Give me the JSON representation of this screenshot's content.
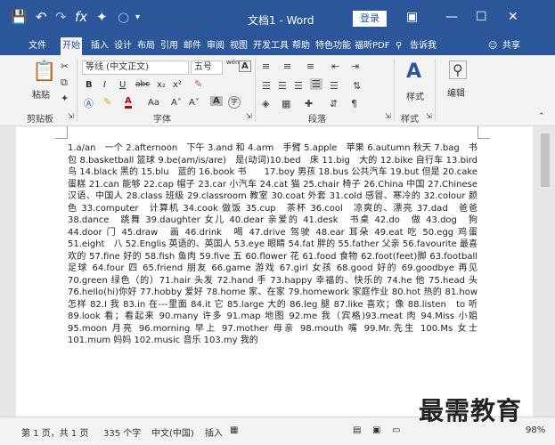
{
  "titlebar": {
    "save_icon": "save-icon",
    "undo_icon": "undo-icon",
    "redo_icon": "redo-icon",
    "formula_icon": "formula-icon",
    "brush_icon": "brush-icon",
    "circle_icon": "circle-icon",
    "customize_icon": "customize-icon",
    "title": "文档1 - Word",
    "login_label": "登录"
  },
  "tabs": [
    {
      "label": "文件"
    },
    {
      "label": "开始"
    },
    {
      "label": "插入"
    },
    {
      "label": "设计"
    },
    {
      "label": "布局"
    },
    {
      "label": "引用"
    },
    {
      "label": "邮件"
    },
    {
      "label": "审阅"
    },
    {
      "label": "视图"
    },
    {
      "label": "开发工具"
    },
    {
      "label": "帮助"
    },
    {
      "label": "特色功能"
    },
    {
      "label": "福昕PDF"
    },
    {
      "label": "告诉我"
    },
    {
      "label": "共享"
    }
  ],
  "ribbon": {
    "paste_label": "粘贴",
    "clipboard_group": "剪贴板",
    "font_name": "等线 (中文正文)",
    "font_size": "五号",
    "wen_label": "wén",
    "font_group": "字体",
    "paragraph_group": "段落",
    "style_label": "样式",
    "style_group": "样式",
    "edit_label": "编辑",
    "bold": "B",
    "italic": "I",
    "underline": "U",
    "strike": "abc",
    "subscript": "x₂",
    "superscript": "x²",
    "font_color_a": "A",
    "grow": "A˄",
    "shrink": "A˅",
    "aa_label": "Aa",
    "boxed_a": "A",
    "char_circle": "字"
  },
  "document": {
    "text": "1.a/an　一个 2.afternoon　下午 3.and 和 4.arm　手臂 5.apple　苹果 6.autumn 秋天 7.bag　书包 8.basketball 篮球 9.be(am/is/are)　是(动词)10.bed　床 11.big　大的 12.bike 自行车 13.bird 鸟 14.black 黑的 15.blu　蓝的 16.book 书　　17.boy 男孩 18.bus 公共汽车 19.but 但是 20.cake　蛋糕 21.can 能够 22.cap 帽子 23.car 小汽车 24.cat 猫 25.chair 椅子 26.China 中国 27.Chinese 汉语、中国人 28.class 班级 29.classroom 教室 30.coat 外套 31.cold 感冒、寒冷的 32.colour 颜色 33.computer　计算机 34.cook 做饭 35.cup　茶杯 36.cool　凉爽的、漂亮 37.dad　爸爸 38.dance　跳舞 39.daughter 女儿 40.dear 亲爱的 41.desk　书桌 42.do　做 43.dog　狗 44.door 门 45.draw　画 46.drink　喝 47.drive 驾驶 48.ear 耳朵 49.eat 吃 50.egg 鸡蛋 51.eight　八 52.Englis 英语的、英国人 53.eye 眼睛 54.fat 胖的 55.father 父亲 56.favourite 最喜欢的 57.fine 好的 58.fish 鱼肉 59.five 五 60.flower 花 61.food 食物 62.foot(feet)脚 63.football 足球 64.four 四 65.friend 朋友 66.game 游戏 67.girl 女孩 68.good 好的 69.goodbye 再见 70.green 绿色（的）71.hair 头发 72.hand 手 73.happy 幸福的、快乐的 74.he 他 75.head 头 76.hello(hi)你好 77.hobby 爱好 78.home 家、在家 79.homework 家庭作业 80.hot 热的 81.how 怎样 82.I 我 83.in 在---里面 84.it 它 85.large 大的 86.leg 腿 87.like 喜欢；像 88.listen　to 听 89.look 看；看起来 90.many 许多 91.map 地图 92.me 我（宾格)93.meat 肉 94.Miss 小姐 95.moon 月亮 96.morning 早上 97.mother 母亲 98.mouth 嘴 99.Mr.先生 100.Ms 女士 101.mum 妈妈 102.music 音乐 103.my 我的"
  },
  "status": {
    "page": "第 1 页，共 1 页",
    "words": "335 个字",
    "lang": "中文(中国)",
    "insert": "插入",
    "zoom": "98%"
  },
  "watermark": "最需教育",
  "colors": {
    "accent": "#2b579a",
    "ribbon_bg": "#f3f3f3",
    "doc_bg": "#e6e6e6"
  }
}
